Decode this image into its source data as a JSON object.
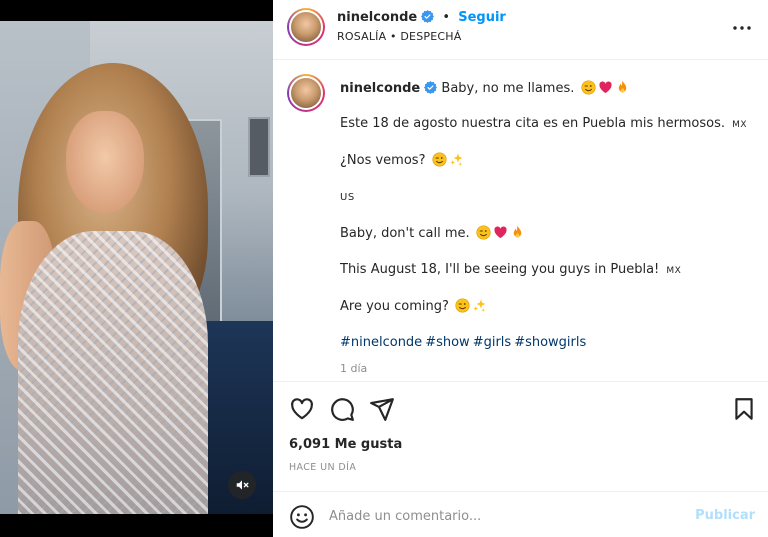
{
  "header": {
    "username": "ninelconde",
    "separator": "•",
    "follow_label": "Seguir",
    "audio_label": "ROSALÍA • DESPECHÁ",
    "more_icon": "more-horizontal-icon"
  },
  "caption": {
    "username": "ninelconde",
    "line1_text": "Baby, no me llames.",
    "line2_text": "Este 18 de agosto nuestra cita es en Puebla mis hermosos.",
    "line2_flag": "MX",
    "line3_text": "¿Nos vemos?",
    "line4_flag": "US",
    "line5_text": "Baby, don't call me.",
    "line6_text": "This August 18, I'll be seeing you guys in Puebla!",
    "line6_flag": "MX",
    "line7_text": "Are you coming?",
    "hashtags": [
      "#ninelconde",
      "#show",
      "#girls",
      "#showgirls"
    ],
    "age": "1 día"
  },
  "actions": {
    "likes": "6,091 Me gusta",
    "timestamp": "HACE UN DÍA",
    "icons": [
      "heart-icon",
      "comment-icon",
      "share-icon",
      "bookmark-icon"
    ]
  },
  "comment_bar": {
    "placeholder": "Añade un comentario...",
    "publish_label": "Publicar"
  },
  "media": {
    "mute_icon": "volume-muted-icon"
  },
  "colors": {
    "accent": "#0095f6",
    "publish_disabled": "#b2dffc",
    "hashtag": "#00376b",
    "muted_text": "#8e8e8e"
  }
}
